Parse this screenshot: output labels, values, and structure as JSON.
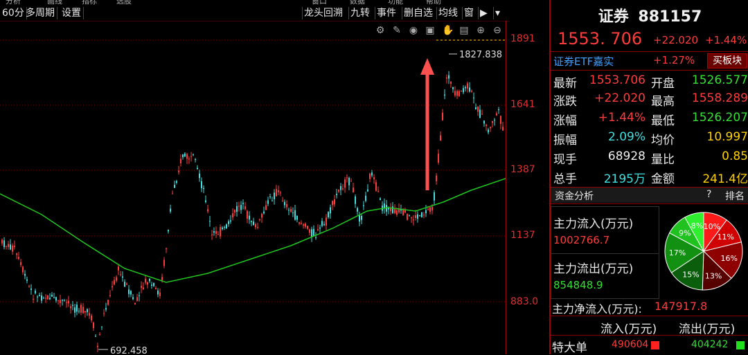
{
  "toolbar": {
    "top_partial": [
      "分析",
      "画线",
      "指标",
      "选股",
      "窗口",
      "数据",
      "功能",
      "帮助"
    ],
    "left": [
      "60分",
      "多周期",
      "设置"
    ],
    "right": [
      "龙头回溯",
      "九转",
      "事件",
      "删自选",
      "均线",
      "窗"
    ],
    "chart_icons": [
      "gear-icon",
      "pen-icon",
      "eye-icon",
      "trash-icon",
      "hand-icon",
      "lock-icon",
      "zoom-in-icon",
      "zoom-out-icon"
    ]
  },
  "chart": {
    "y_labels": [
      "1891",
      "1641",
      "1387",
      "1137",
      "883.0"
    ],
    "high_label": "1827.838",
    "low_label": "692.458",
    "colors": {
      "up": "#ff3c3c",
      "down": "#40e0e0",
      "ma": "#1ec81e",
      "arrow": "#ff5050"
    }
  },
  "quote": {
    "name": "证券",
    "code": "881157",
    "price": "1553. 706",
    "change": "+22.020",
    "change_pct": "+1.44%",
    "etf_name": "证券ETF嘉实",
    "etf_pct": "+1.27%",
    "sector_btn": "买板块",
    "rows": [
      {
        "l1": "最新",
        "v1": "1553.706",
        "l2": "开盘",
        "v2": "1526.577"
      },
      {
        "l1": "涨跌",
        "v1": "+22.020",
        "l2": "最高",
        "v2": "1558.289"
      },
      {
        "l1": "涨幅",
        "v1": "+1.44%",
        "l2": "最低",
        "v2": "1526.207"
      },
      {
        "l1": "振幅",
        "v1": "2.09%",
        "l2": "均价",
        "v2": "10.997"
      },
      {
        "l1": "现手",
        "v1": "68928",
        "l2": "量比",
        "v2": "0.85"
      },
      {
        "l1": "总手",
        "v1": "2195万",
        "l2": "金额",
        "v2": "241.4亿"
      }
    ]
  },
  "fund": {
    "title": "资金分析",
    "help": "?",
    "rank": "排名",
    "inflow_label": "主力流入(万元)",
    "inflow_value": "1002766.7",
    "outflow_label": "主力流出(万元)",
    "outflow_value": "854848.9",
    "net_label": "主力净流入(万元):",
    "net_value": "147917.8",
    "col_in": "流入(万元)",
    "col_out": "流出(万元)",
    "row_label": "特大单",
    "row_in": "490604",
    "row_out": "404242",
    "pie": [
      {
        "label": "10%",
        "value": 10,
        "color": "#ff1a1a"
      },
      {
        "label": "11%",
        "value": 11,
        "color": "#d10000"
      },
      {
        "label": "16%",
        "value": 16,
        "color": "#8f0000"
      },
      {
        "label": "13%",
        "value": 13,
        "color": "#560000"
      },
      {
        "label": "15%",
        "value": 15,
        "color": "#0b5e0b"
      },
      {
        "label": "17%",
        "value": 17,
        "color": "#129012"
      },
      {
        "label": "9%",
        "value": 9,
        "color": "#1fc21f"
      },
      {
        "label": "8%",
        "value": 8,
        "color": "#2ef02e"
      }
    ]
  }
}
